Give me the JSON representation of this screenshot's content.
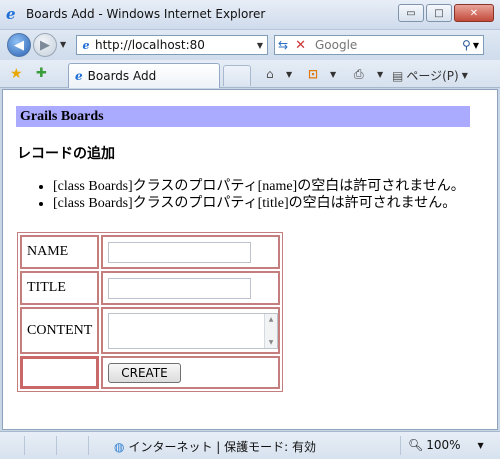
{
  "window": {
    "title": "Boards Add - Windows Internet Explorer",
    "buttons": {
      "minimize": "▭",
      "maximize": "□",
      "close": "✕"
    }
  },
  "address_bar": {
    "url": "http://localhost:80",
    "search_placeholder": "Google"
  },
  "tabs": [
    {
      "label": "Boards Add",
      "active": true
    }
  ],
  "command_bar": {
    "page_label": "ページ(P)"
  },
  "page": {
    "header": "Grails Boards",
    "heading": "レコードの追加",
    "errors": [
      "[class Boards]クラスのプロパティ[name]の空白は許可されません。",
      "[class Boards]クラスのプロパティ[title]の空白は許可されません。"
    ],
    "form": {
      "name_label": "NAME",
      "name_value": "",
      "title_label": "TITLE",
      "title_value": "",
      "content_label": "CONTENT",
      "content_value": "",
      "submit_label": "CREATE"
    }
  },
  "status_bar": {
    "zone": "インターネット | 保護モード: 有効",
    "zoom": "100%"
  },
  "icons": {
    "ie": "ie-logo-icon",
    "back": "back-arrow-icon",
    "forward": "forward-arrow-icon",
    "refresh": "refresh-icon",
    "stop": "stop-icon",
    "search": "search-icon",
    "favorites": "favorites-star-icon",
    "add_favorites": "add-favorites-icon",
    "home": "home-icon",
    "feeds": "feeds-icon",
    "print": "print-icon",
    "page": "page-icon",
    "globe": "globe-icon",
    "zoom": "zoom-icon"
  }
}
